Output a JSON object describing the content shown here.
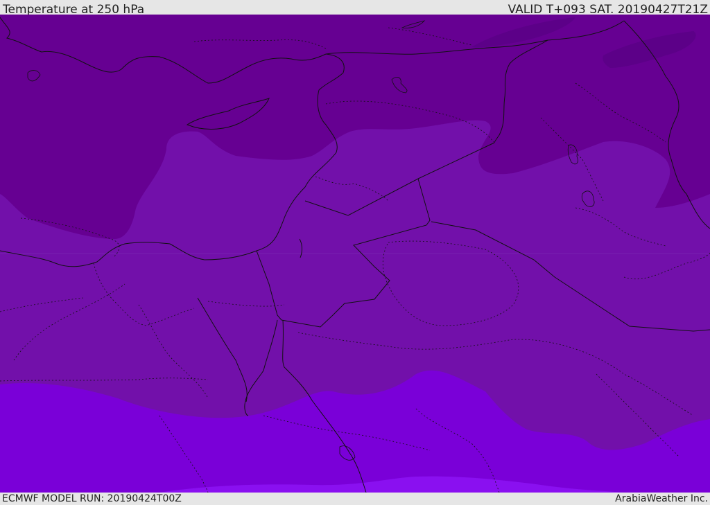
{
  "header": {
    "title": "Temperature at 250 hPa",
    "valid": "VALID T+093 SAT. 20190427T21Z"
  },
  "footer": {
    "model_run": "ECMWF MODEL RUN: 20190424T00Z",
    "credit": "ArabiaWeather Inc."
  },
  "colors": {
    "coldest": "#5c0088",
    "cold": "#660092",
    "mid": "#7210aa",
    "warm": "#6e12a8",
    "warmer": "#7a00d8",
    "warmest": "#8a10f0",
    "border": "#111111"
  }
}
